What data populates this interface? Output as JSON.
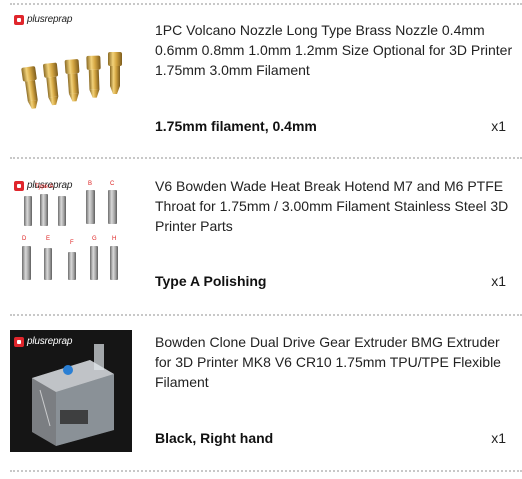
{
  "items": [
    {
      "title": "1PC Volcano Nozzle Long Type Brass Nozzle 0.4mm 0.6mm 0.8mm 1.0mm 1.2mm Size Optional for 3D Printer 1.75mm 3.0mm Filament",
      "variant": "1.75mm filament, 0.4mm",
      "qty": "x1",
      "brand_logo": "plusreprap"
    },
    {
      "title": "V6 Bowden Wade Heat Break Hotend M7 and M6 PTFE Throat for 1.75mm / 3.00mm Filament Stainless Steel 3D Printer Parts",
      "variant": "Type A Polishing",
      "qty": "x1",
      "brand_logo": "plusreprap",
      "image_labels": [
        "Type A",
        "B",
        "C",
        "D",
        "E",
        "F",
        "G",
        "H"
      ]
    },
    {
      "title": "Bowden Clone Dual Drive Gear Extruder BMG Extruder for 3D Printer MK8 V6 CR10 1.75mm TPU/TPE Flexible Filament",
      "variant": "Black, Right hand",
      "qty": "x1",
      "brand_logo": "plusreprap"
    }
  ]
}
